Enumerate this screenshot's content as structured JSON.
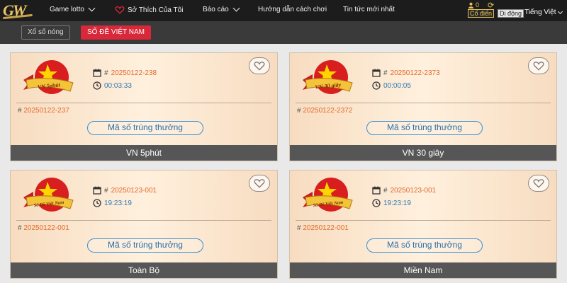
{
  "header": {
    "logo_text": "GW",
    "nav": [
      {
        "label": "Game lotto"
      },
      {
        "label": "Sở Thích Của Tôi"
      },
      {
        "label": "Báo cáo"
      },
      {
        "label": "Hướng dẫn cách chơi"
      },
      {
        "label": "Tin tức mới nhất"
      }
    ],
    "user_count": "0",
    "mode_classic": "Cổ điển",
    "mode_mobile": "Di động",
    "language": "Tiếng Việt"
  },
  "tabs": {
    "hot": "Xổ số nóng",
    "active": "SỐ ĐỀ VIỆT NAM"
  },
  "cards": [
    {
      "emblem": "VN 5phút",
      "current_draw": "20250122-238",
      "timer": "00:03:33",
      "previous_draw": "20250122-237",
      "result_button": "Mã số trúng thưởng",
      "title": "VN 5phút"
    },
    {
      "emblem": "VN 30 giây",
      "current_draw": "20250122-2373",
      "timer": "00:00:05",
      "previous_draw": "20250122-2372",
      "result_button": "Mã số trúng thưởng",
      "title": "VN 30 giây"
    },
    {
      "emblem": "Số Đề Việt Nam",
      "current_draw": "20250123-001",
      "timer": "19:23:19",
      "previous_draw": "20250122-001",
      "result_button": "Mã số trúng thưởng",
      "title": "Toàn Bộ"
    },
    {
      "emblem": "Số Đề Việt Nam",
      "current_draw": "20250123-001",
      "timer": "19:23:19",
      "previous_draw": "20250122-001",
      "result_button": "Mã số trúng thưởng",
      "title": "Miền Nam"
    }
  ],
  "colors": {
    "nav_bg": "#1c1c1c",
    "tab_active": "#d8283a",
    "draw_id": "#e36a2f",
    "timer": "#2a7ab5",
    "card_footer": "#565656"
  },
  "icons": {
    "favorite": "heart-outline-icon",
    "calendar": "calendar-icon",
    "clock": "clock-icon",
    "user": "user-icon",
    "refresh": "refresh-icon"
  }
}
